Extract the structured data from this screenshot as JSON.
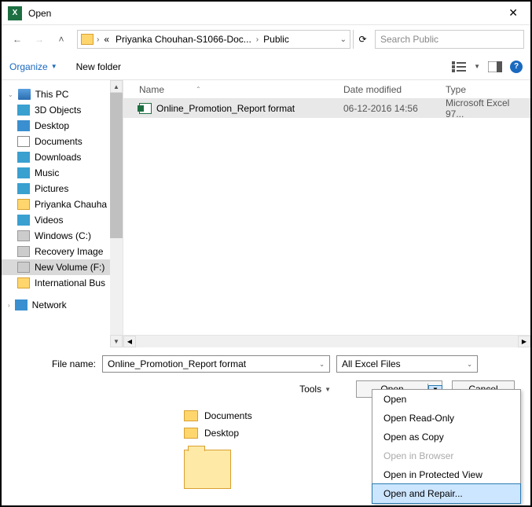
{
  "titlebar": {
    "title": "Open"
  },
  "breadcrumb": {
    "prefix": "«",
    "seg1": "Priyanka Chouhan-S1066-Doc...",
    "seg2": "Public"
  },
  "search": {
    "placeholder": "Search Public"
  },
  "toolbar": {
    "organize": "Organize",
    "newfolder": "New folder"
  },
  "tree": {
    "thispc": "This PC",
    "items": [
      "3D Objects",
      "Desktop",
      "Documents",
      "Downloads",
      "Music",
      "Pictures",
      "Priyanka Chauha",
      "Videos",
      "Windows (C:)",
      "Recovery Image",
      "New Volume (F:)",
      "International Bus"
    ],
    "network": "Network"
  },
  "columns": {
    "name": "Name",
    "date": "Date modified",
    "type": "Type"
  },
  "file": {
    "name": "Online_Promotion_Report  format",
    "date": "06-12-2016 14:56",
    "type": "Microsoft Excel 97..."
  },
  "footer": {
    "label": "File name:",
    "value": "Online_Promotion_Report  format",
    "filter": "All Excel Files",
    "tools": "Tools",
    "open": "Open",
    "cancel": "Cancel"
  },
  "dropdown": {
    "items": [
      "Open",
      "Open Read-Only",
      "Open as Copy",
      "Open in Browser",
      "Open in Protected View",
      "Open and Repair..."
    ]
  },
  "lower": {
    "documents": "Documents",
    "desktop": "Desktop"
  }
}
